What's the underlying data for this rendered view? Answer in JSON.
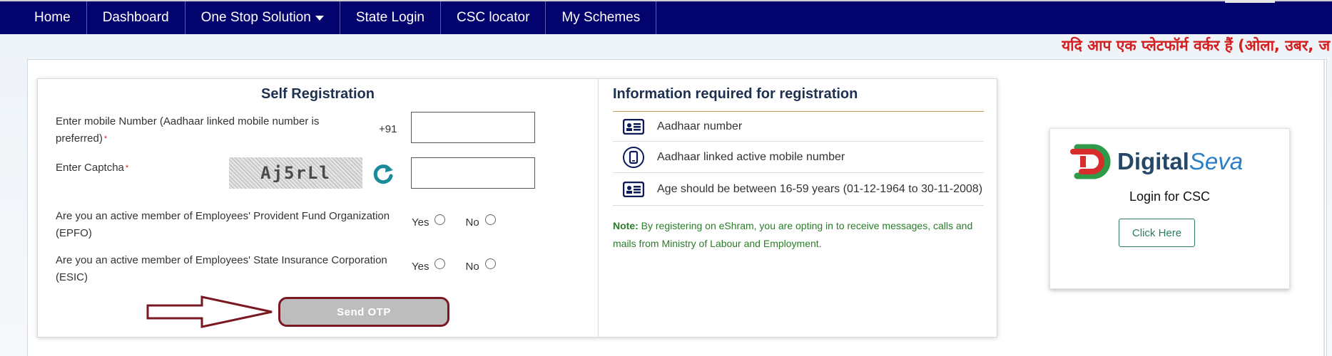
{
  "nav": {
    "items": [
      {
        "label": "Home"
      },
      {
        "label": "Dashboard"
      },
      {
        "label": "One Stop Solution"
      },
      {
        "label": "State Login"
      },
      {
        "label": "CSC locator"
      },
      {
        "label": "My Schemes"
      }
    ]
  },
  "marquee": {
    "text": "यदि आप एक प्लेटफॉर्म वर्कर हैं (ओला, उबर, ज"
  },
  "registration": {
    "title": "Self Registration",
    "mobile_label": "Enter mobile Number (Aadhaar linked mobile number is preferred)",
    "required_mark": "*",
    "mobile_prefix": "+91",
    "mobile_value": "",
    "captcha_label": "Enter Captcha",
    "captcha_text": "Aj5rLl",
    "captcha_value": "",
    "epfo_question": "Are you an active member of Employees' Provident Fund Organization (EPFO)",
    "esic_question": "Are you an active member of Employees' State Insurance Corporation (ESIC)",
    "yes_label": "Yes",
    "no_label": "No",
    "send_otp_label": "Send OTP"
  },
  "info": {
    "title": "Information required for registration",
    "items": [
      {
        "text": "Aadhaar number",
        "icon": "id-card-icon"
      },
      {
        "text": "Aadhaar linked active mobile number",
        "icon": "mobile-icon"
      },
      {
        "text": "Age should be between 16-59 years (01-12-1964 to 30-11-2008)",
        "icon": "id-card-icon"
      }
    ],
    "note_label": "Note:",
    "note_text": "By registering on eShram, you are opting in to receive messages, calls and mails from Ministry of Labour and Employment."
  },
  "csc": {
    "logo_text_1": "Digital",
    "logo_text_2": "Seva",
    "login_label": "Login for CSC",
    "button_label": "Click Here"
  },
  "colors": {
    "nav_bg": "#03036e",
    "marquee": "#d31f1f",
    "note": "#2a7d2a",
    "otp_border": "#7a1822",
    "refresh": "#1b8a9a"
  }
}
